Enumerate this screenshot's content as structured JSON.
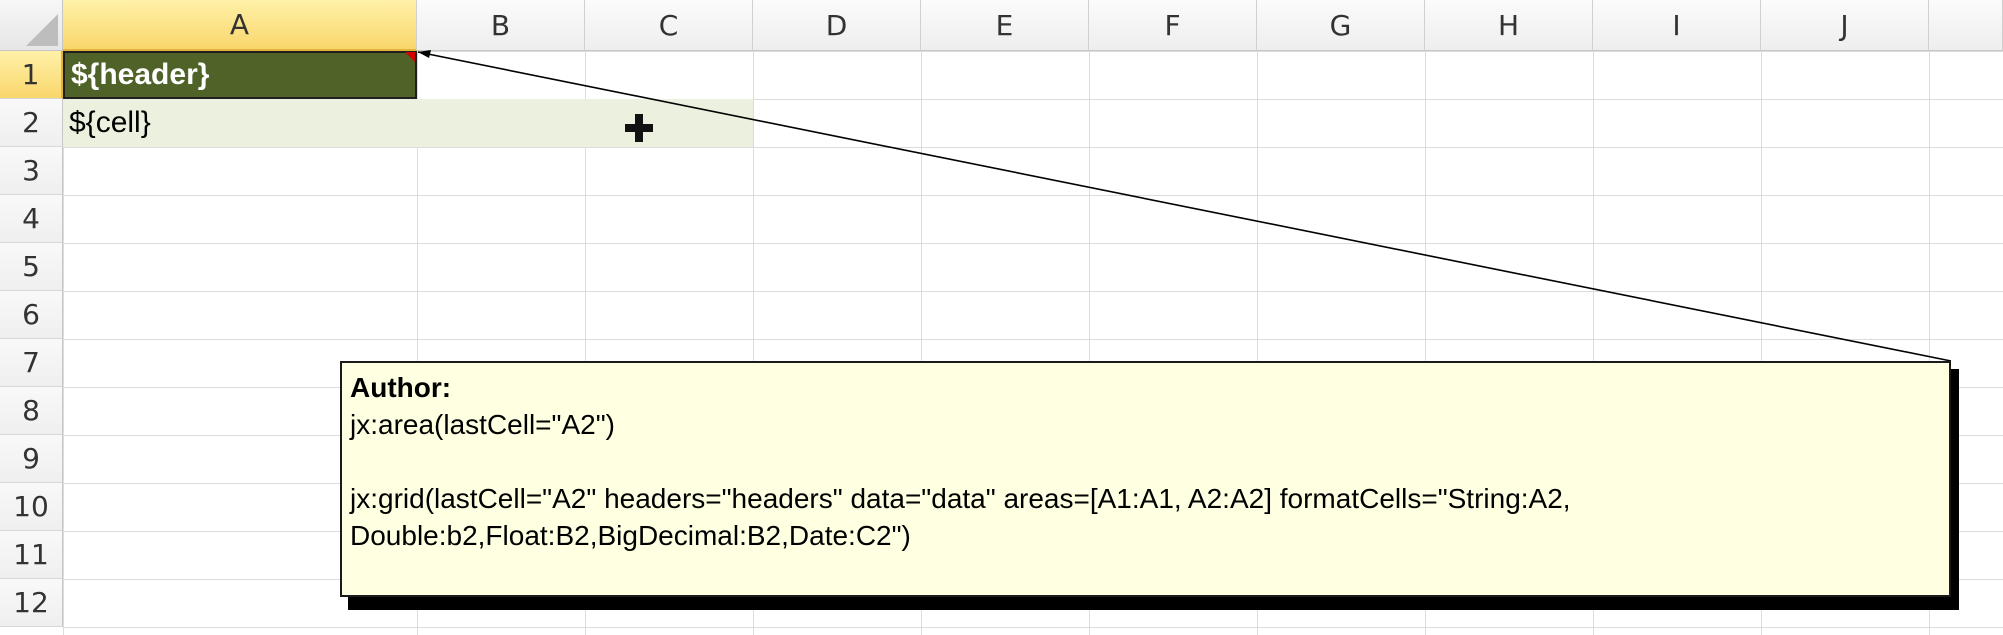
{
  "sheet": {
    "columns": [
      "A",
      "B",
      "C",
      "D",
      "E",
      "F",
      "G",
      "H",
      "I",
      "J"
    ],
    "rows": [
      "1",
      "2",
      "3",
      "4",
      "5",
      "6",
      "7",
      "8",
      "9",
      "10",
      "11",
      "12"
    ]
  },
  "cells": {
    "a1": "${header}",
    "a2": "${cell}"
  },
  "comment": {
    "author": "Author:",
    "line1": "jx:area(lastCell=\"A2\")",
    "line2": "jx:grid(lastCell=\"A2\" headers=\"headers\" data=\"data\" areas=[A1:A1, A2:A2] formatCells=\"String:A2,",
    "line3": "Double:b2,Float:B2,BigDecimal:B2,Date:C2\")"
  },
  "colors": {
    "header_cell_fill": "#4f6228",
    "data_cell_fill": "#ebf1de",
    "comment_fill": "#ffffe1",
    "comment_indicator": "#d40000",
    "active_header": "#f9d66c"
  },
  "icons": {
    "select_all": "select-all-triangle-icon",
    "cursor": "cell-plus-cursor-icon",
    "comment_indicator": "comment-indicator-icon"
  }
}
